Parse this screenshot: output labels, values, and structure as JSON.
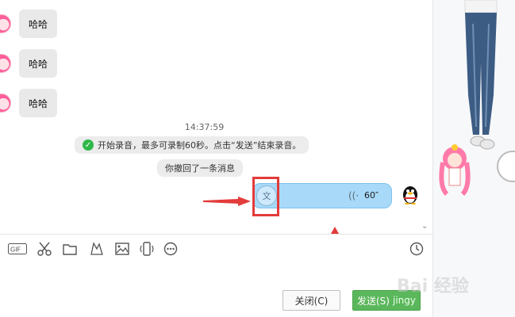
{
  "messages": [
    {
      "text": "哈哈"
    },
    {
      "text": "哈哈"
    },
    {
      "text": "哈哈"
    }
  ],
  "timestamp": "14:37:59",
  "system_tip_recording": "开始录音，最多可录制60秒。点击“发送”结束录音。",
  "system_tip_recall": "你撤回了一条消息",
  "voice_message": {
    "transcribe_icon_label": "文",
    "duration": "60″"
  },
  "toolbar": {
    "gif_label": "GIF",
    "icons": [
      "gif-icon",
      "scissors-icon",
      "folder-icon",
      "doodle-icon",
      "image-icon",
      "phone-shake-icon",
      "more-icon",
      "history-clock-icon"
    ]
  },
  "buttons": {
    "close_label": "关闭(C)",
    "send_label": "发送(S)",
    "send_overlay_text": "jingy"
  },
  "watermark": "Bai 经验",
  "colors": {
    "send_button": "#5bb75b",
    "voice_bubble": "#a8d9f8",
    "highlight": "#e43b3b",
    "check_green": "#2fb84a"
  }
}
